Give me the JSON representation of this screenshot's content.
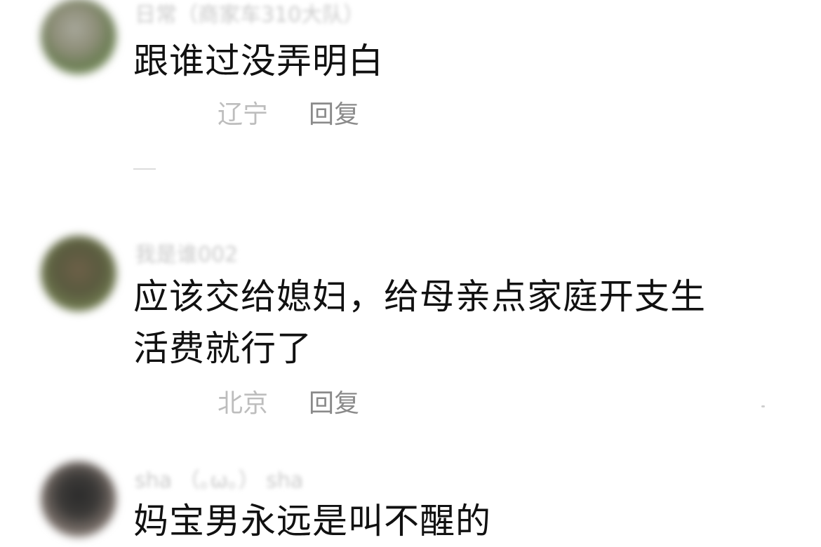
{
  "comments": [
    {
      "username": "日常（商家车310大队）",
      "text": "跟谁过没弄明白",
      "location": "辽宁",
      "reply_label": "回复"
    },
    {
      "username": "我是谁002",
      "text_line1": "应该交给媳妇，给母亲点家庭开支生",
      "text_line2": "活费就行了",
      "location": "北京",
      "reply_label": "回复"
    },
    {
      "username": "sha （｡ω｡） sha",
      "text": "妈宝男永远是叫不醒的"
    }
  ]
}
